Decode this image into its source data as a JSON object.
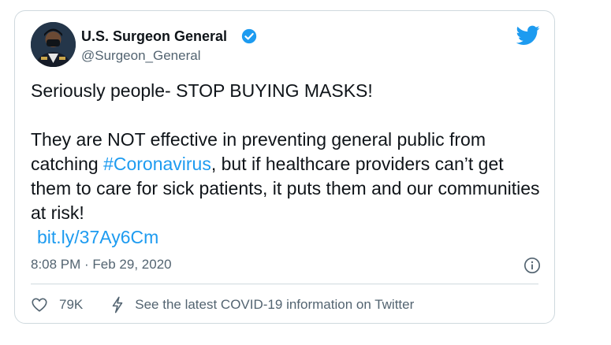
{
  "author": {
    "name": "U.S. Surgeon General",
    "handle": "@Surgeon_General",
    "verified": true,
    "avatar": "profile-photo"
  },
  "tweet": {
    "paragraph1": "Seriously people- STOP BUYING MASKS!",
    "para2_part1": "They are NOT effective in preventing general public from catching ",
    "hashtag": "#Coronavirus",
    "para2_part2": ", but if healthcare providers can’t get them to care for sick patients, it puts them and our communities at risk!",
    "link": "bit.ly/37Ay6Cm"
  },
  "meta": {
    "time": "8:08 PM · Feb 29, 2020"
  },
  "actions": {
    "like_count": "79K",
    "covid_info": "See the latest COVID-19 information on Twitter"
  },
  "icons": {
    "brand": "twitter-bird-icon",
    "verified": "verified-badge-icon",
    "info": "info-icon",
    "like": "heart-icon",
    "covid": "lightning-bolt-icon"
  },
  "colors": {
    "accent": "#1d9bf0",
    "text": "#0f1419",
    "secondary": "#536471",
    "border": "#cfd9de"
  }
}
